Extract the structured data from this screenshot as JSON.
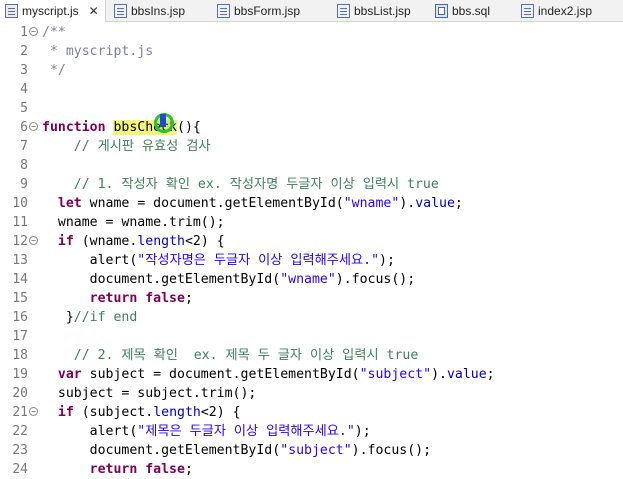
{
  "tabs": [
    {
      "label": "myscript.js",
      "icon": "js-file-icon",
      "active": true
    },
    {
      "label": "bbsIns.jsp",
      "icon": "jsp-file-icon",
      "active": false
    },
    {
      "label": "bbsForm.jsp",
      "icon": "jsp-file-icon",
      "active": false
    },
    {
      "label": "bbsList.jsp",
      "icon": "jsp-file-icon",
      "active": false
    },
    {
      "label": "bbs.sql",
      "icon": "sql-file-icon",
      "active": false
    },
    {
      "label": "index2.jsp",
      "icon": "jsp-file-icon",
      "active": false
    }
  ],
  "close_glyph": "✕",
  "fold_glyph": "−",
  "colors": {
    "keyword": "#7f0055",
    "string": "#2a00ff",
    "comment": "#3f7f5f",
    "property": "#0000c0",
    "highlight": "#f3f57a"
  },
  "lines": [
    {
      "n": "1",
      "fold": true,
      "tokens": [
        {
          "t": "/**",
          "c": "doc"
        }
      ]
    },
    {
      "n": "2",
      "tokens": [
        {
          "t": " * myscript.js",
          "c": "doc"
        }
      ]
    },
    {
      "n": "3",
      "tokens": [
        {
          "t": " */",
          "c": "doc"
        }
      ]
    },
    {
      "n": "4",
      "tokens": []
    },
    {
      "n": "5",
      "tokens": []
    },
    {
      "n": "6",
      "fold": true,
      "tokens": [
        {
          "t": "function",
          "c": "kw"
        },
        {
          "t": " "
        },
        {
          "t": "bbsCheck",
          "c": "hl"
        },
        {
          "t": "(){"
        }
      ]
    },
    {
      "n": "7",
      "tokens": [
        {
          "t": "    // 게시판 유효성 검사",
          "c": "cm"
        }
      ]
    },
    {
      "n": "8",
      "tokens": []
    },
    {
      "n": "9",
      "tokens": [
        {
          "t": "    // 1. 작성자 확인 ex. 작성자명 두글자 이상 입력시 true",
          "c": "cm"
        }
      ]
    },
    {
      "n": "10",
      "tokens": [
        {
          "t": "  "
        },
        {
          "t": "let",
          "c": "kw"
        },
        {
          "t": " wname = document.getElementById("
        },
        {
          "t": "\"wname\"",
          "c": "str"
        },
        {
          "t": ")."
        },
        {
          "t": "value",
          "c": "prop"
        },
        {
          "t": ";"
        }
      ]
    },
    {
      "n": "11",
      "tokens": [
        {
          "t": "  wname = wname.trim();"
        }
      ]
    },
    {
      "n": "12",
      "fold": true,
      "tokens": [
        {
          "t": "  "
        },
        {
          "t": "if",
          "c": "kw"
        },
        {
          "t": " (wname."
        },
        {
          "t": "length",
          "c": "prop"
        },
        {
          "t": "<2) {"
        }
      ]
    },
    {
      "n": "13",
      "tokens": [
        {
          "t": "      alert("
        },
        {
          "t": "\"작성자명은 두글자 이상 입력해주세요.\"",
          "c": "str"
        },
        {
          "t": ");"
        }
      ]
    },
    {
      "n": "14",
      "tokens": [
        {
          "t": "      document.getElementById("
        },
        {
          "t": "\"wname\"",
          "c": "str"
        },
        {
          "t": ").focus();"
        }
      ]
    },
    {
      "n": "15",
      "tokens": [
        {
          "t": "      "
        },
        {
          "t": "return",
          "c": "kw"
        },
        {
          "t": " "
        },
        {
          "t": "false",
          "c": "kw"
        },
        {
          "t": ";"
        }
      ]
    },
    {
      "n": "16",
      "tokens": [
        {
          "t": "   }"
        },
        {
          "t": "//if end",
          "c": "cm"
        }
      ]
    },
    {
      "n": "17",
      "tokens": []
    },
    {
      "n": "18",
      "tokens": [
        {
          "t": "    // 2. 제목 확인  ex. 제목 두 글자 이상 입력시 true",
          "c": "cm"
        }
      ]
    },
    {
      "n": "19",
      "tokens": [
        {
          "t": "  "
        },
        {
          "t": "var",
          "c": "kw"
        },
        {
          "t": " subject = document.getElementById("
        },
        {
          "t": "\"subject\"",
          "c": "str"
        },
        {
          "t": ")."
        },
        {
          "t": "value",
          "c": "prop"
        },
        {
          "t": ";"
        }
      ]
    },
    {
      "n": "20",
      "tokens": [
        {
          "t": "  subject = subject.trim();"
        }
      ]
    },
    {
      "n": "21",
      "fold": true,
      "tokens": [
        {
          "t": "  "
        },
        {
          "t": "if",
          "c": "kw"
        },
        {
          "t": " (subject."
        },
        {
          "t": "length",
          "c": "prop"
        },
        {
          "t": "<2) {"
        }
      ]
    },
    {
      "n": "22",
      "tokens": [
        {
          "t": "      alert("
        },
        {
          "t": "\"제목은 두글자 이상 입력해주세요.\"",
          "c": "str"
        },
        {
          "t": ");"
        }
      ]
    },
    {
      "n": "23",
      "tokens": [
        {
          "t": "      document.getElementById("
        },
        {
          "t": "\"subject\"",
          "c": "str"
        },
        {
          "t": ").focus();"
        }
      ]
    },
    {
      "n": "24",
      "tokens": [
        {
          "t": "      "
        },
        {
          "t": "return",
          "c": "kw"
        },
        {
          "t": " "
        },
        {
          "t": "false",
          "c": "kw"
        },
        {
          "t": ";"
        }
      ]
    }
  ]
}
